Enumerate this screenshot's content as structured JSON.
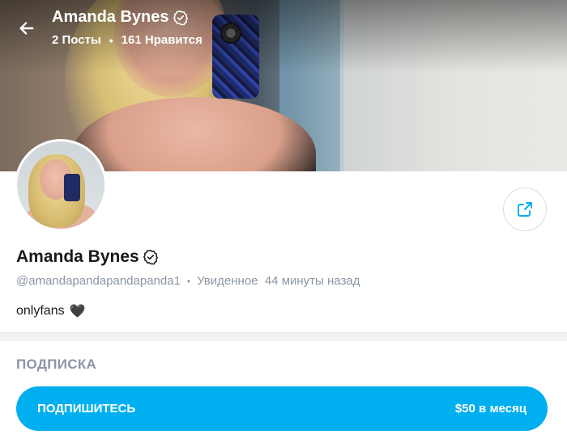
{
  "header": {
    "name": "Amanda Bynes",
    "posts": "2 Посты",
    "likes": "161 Нравится",
    "separator": "•"
  },
  "profile": {
    "name": "Amanda Bynes",
    "username": "@amandapandapandapanda1",
    "separator": "•",
    "last_seen": "Увиденное  44 минуты назад",
    "bio": "onlyfans",
    "bio_emoji": "🖤"
  },
  "subscription": {
    "heading": "ПОДПИСКА",
    "button_label": "ПОДПИШИТЕСЬ",
    "price": "$50 в месяц"
  },
  "colors": {
    "accent": "#00aff0",
    "muted_text": "#8a96a3"
  },
  "icons": {
    "back": "arrow-left-icon",
    "verified": "verified-badge-icon",
    "share": "share-icon"
  }
}
